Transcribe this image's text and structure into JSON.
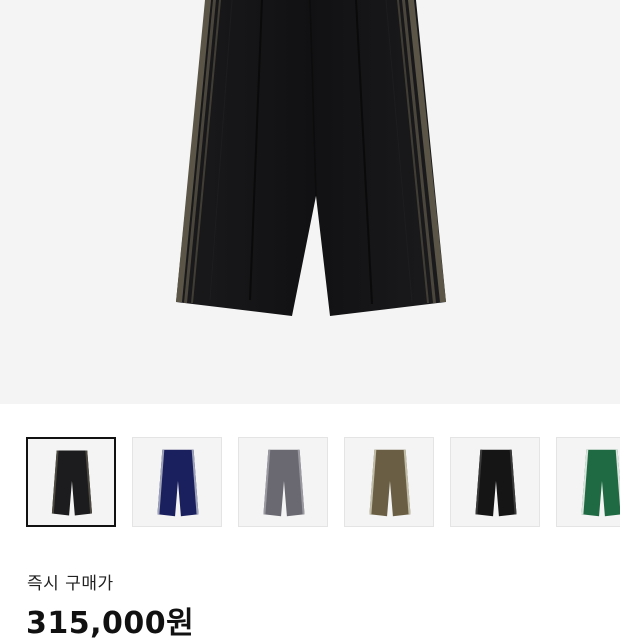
{
  "product": {
    "main_image_icon": "track-pants-black-image",
    "main_colors": {
      "body": "#141416",
      "stripe": "#5a5546"
    }
  },
  "thumbnails": [
    {
      "icon": "pants-black-thumb",
      "body": "#1c1c1e",
      "stripe": "#4c4a40",
      "selected": true
    },
    {
      "icon": "pants-navy-thumb",
      "body": "#1a1f5e",
      "stripe": "#9ea2b8",
      "selected": false
    },
    {
      "icon": "pants-grey-thumb",
      "body": "#6a6870",
      "stripe": "#9a98a0",
      "selected": false
    },
    {
      "icon": "pants-olive-thumb",
      "body": "#6a5f44",
      "stripe": "#c2bda8",
      "selected": false
    },
    {
      "icon": "pants-black-wide-thumb",
      "body": "#151515",
      "stripe": "#3a3a3a",
      "selected": false
    },
    {
      "icon": "pants-green-thumb",
      "body": "#1f6a42",
      "stripe": "#d8e4dc",
      "selected": false
    }
  ],
  "purchase": {
    "label": "즉시 구매가",
    "price": "315,000원"
  }
}
